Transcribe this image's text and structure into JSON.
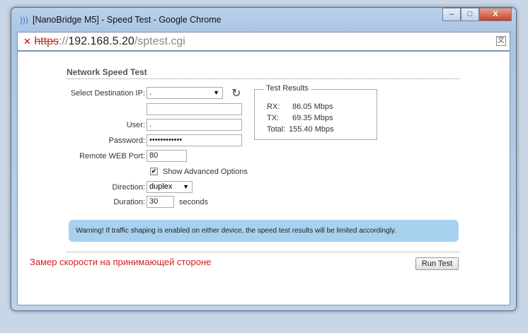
{
  "window": {
    "title": "[NanoBridge M5] - Speed Test - Google Chrome",
    "min": "–",
    "max": "□",
    "close": "X"
  },
  "address": {
    "scheme": "https",
    "sep": "://",
    "host": "192.168.5.20",
    "path": "/sptest.cgi",
    "lock": "✕",
    "translate": "文"
  },
  "page": {
    "heading": "Network Speed Test",
    "dest_label": "Select Destination IP:",
    "dest_value": ".",
    "user_label": "User:",
    "user_value": ".",
    "password_label": "Password:",
    "password_value": "••••••••••••",
    "port_label": "Remote WEB Port:",
    "port_value": "80",
    "advanced_label": "Show Advanced Options",
    "advanced_check": "✔",
    "direction_label": "Direction:",
    "direction_value": "duplex",
    "duration_label": "Duration:",
    "duration_value": "30",
    "duration_unit": "seconds",
    "refresh": "↻",
    "results": {
      "legend": "Test Results",
      "rx_label": "RX:",
      "rx": "86.05 Mbps",
      "tx_label": "TX:",
      "tx": "69.35 Mbps",
      "total_label": "Total:",
      "total": "155.40 Mbps"
    },
    "warning": "Warning! If traffic shaping is enabled on either device, the speed test results will be limited accordingly.",
    "note": "Замер скорости на принимающей стороне",
    "run": "Run Test"
  }
}
